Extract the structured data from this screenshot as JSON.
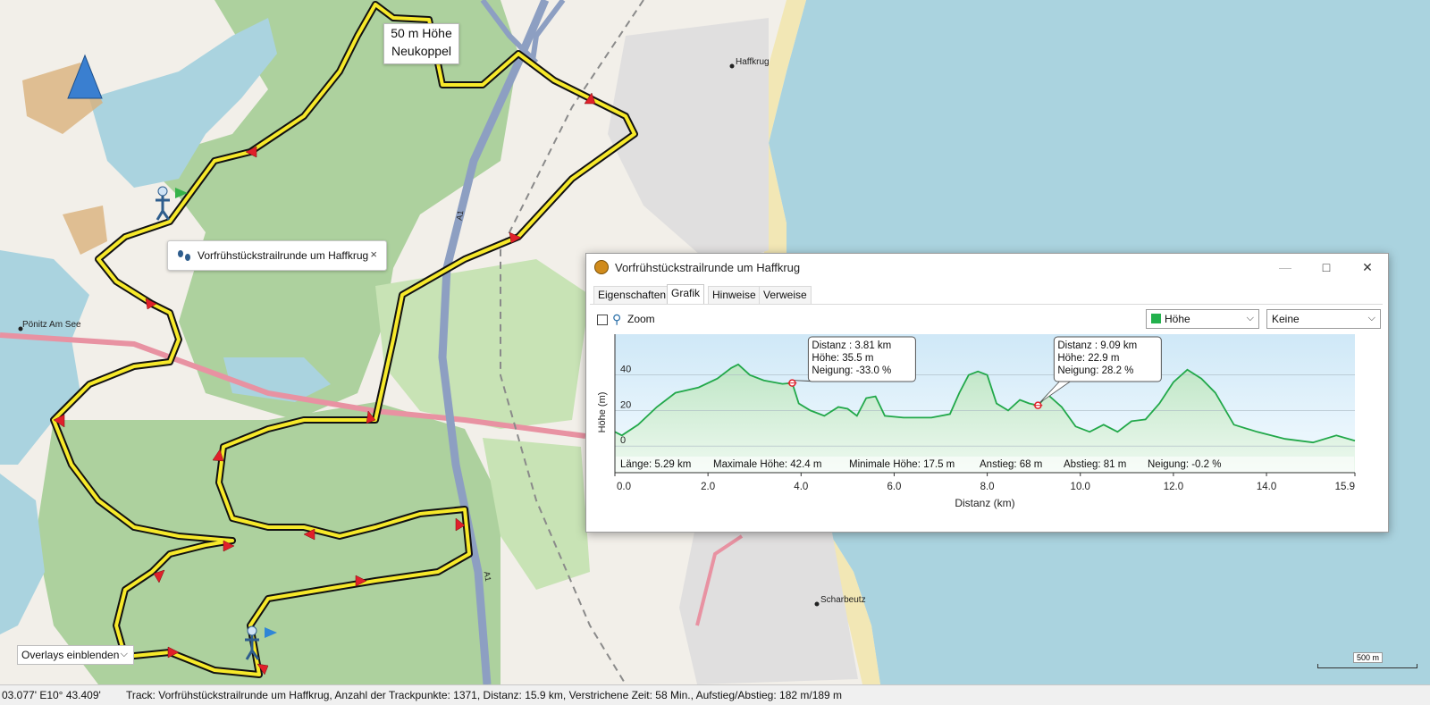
{
  "map": {
    "places": [
      "Haffkrug",
      "Pönitz Am See",
      "Scharbeutz"
    ],
    "road_labels": [
      "A1",
      "A1"
    ],
    "scale_label": "500 m",
    "height_tooltip": {
      "line1": "50 m Höhe",
      "line2": "Neukoppel"
    },
    "track_tag": {
      "label": "Vorfrühstückstrailrunde um Haffkrug",
      "close": "×"
    },
    "overlay_button": "Overlays einblenden",
    "colors": {
      "water": "#aad3df",
      "forest": "#add19e",
      "land": "#f2efe9",
      "track": "#f7e92a",
      "arrow": "#e0202a"
    }
  },
  "dialog": {
    "title": "Vorfrühstückstrailrunde um Haffkrug",
    "minimize": "—",
    "maximize": "□",
    "close": "✕",
    "tabs": [
      "Eigenschaften",
      "Grafik",
      "Hinweise",
      "Verweise"
    ],
    "active_tab": "Grafik",
    "zoom_label": "Zoom",
    "zoom_checked": false,
    "select_series": "Höhe",
    "select_overlay": "Keine",
    "stats": {
      "length": "Länge: 5.29 km",
      "max": "Maximale Höhe: 42.4 m",
      "min": "Minimale Höhe: 17.5 m",
      "ascent": "Anstieg: 68 m",
      "descent": "Abstieg: 81 m",
      "grade": "Neigung: -0.2 %"
    },
    "markers": [
      {
        "lines": [
          "Distanz : 3.81 km",
          "Höhe: 35.5 m",
          "Neigung: -33.0 %"
        ],
        "x": 3.81,
        "y": 35.5
      },
      {
        "lines": [
          "Distanz : 9.09 km",
          "Höhe: 22.9 m",
          "Neigung: 28.2 %"
        ],
        "x": 9.09,
        "y": 22.9
      }
    ]
  },
  "chart_data": {
    "type": "area",
    "xlabel": "Distanz  (km)",
    "ylabel": "Höhe (m)",
    "xlim": [
      0,
      15.9
    ],
    "ylim": [
      -15,
      63
    ],
    "x_ticks": [
      0,
      2,
      4,
      6,
      8,
      10,
      12,
      14,
      15.9
    ],
    "x_tick_labels": [
      "0.0",
      "2.0",
      "4.0",
      "6.0",
      "8.0",
      "10.0",
      "12.0",
      "14.0",
      "15.9"
    ],
    "y_ticks": [
      0,
      20,
      40
    ],
    "grid": true,
    "series": [
      {
        "name": "Höhe",
        "color": "#22a84a",
        "x": [
          0,
          0.15,
          0.5,
          0.9,
          1.3,
          1.8,
          2.2,
          2.5,
          2.65,
          2.9,
          3.2,
          3.6,
          3.81,
          3.95,
          4.2,
          4.5,
          4.8,
          5.0,
          5.2,
          5.4,
          5.6,
          5.8,
          6.2,
          6.8,
          7.2,
          7.4,
          7.6,
          7.8,
          8.0,
          8.2,
          8.45,
          8.7,
          8.9,
          9.09,
          9.3,
          9.6,
          9.9,
          10.2,
          10.5,
          10.8,
          11.1,
          11.4,
          11.7,
          12.0,
          12.3,
          12.6,
          12.9,
          13.3,
          13.8,
          14.4,
          15.0,
          15.5,
          15.9
        ],
        "y": [
          8,
          6,
          12,
          22,
          30,
          33,
          38,
          44,
          46,
          40,
          37,
          35,
          35.5,
          24,
          20,
          17,
          22,
          21,
          17,
          27,
          28,
          17,
          16,
          16,
          18,
          30,
          40,
          42,
          40,
          24,
          20,
          26,
          24,
          22.9,
          29,
          22,
          11,
          8,
          12,
          8,
          14,
          15,
          24,
          36,
          43,
          38,
          30,
          12,
          8,
          4,
          2,
          6,
          3
        ]
      }
    ]
  },
  "statusbar": {
    "coords": "03.077' E10° 43.409'",
    "track_info": "Track: Vorfrühstückstrailrunde um Haffkrug, Anzahl der Trackpunkte: 1371, Distanz: 15.9 km, Verstrichene Zeit: 58 Min., Aufstieg/Abstieg: 182 m/189 m"
  }
}
